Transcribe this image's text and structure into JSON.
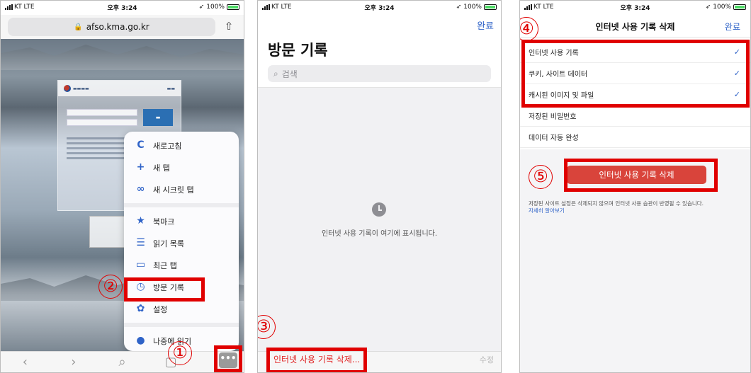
{
  "status": {
    "carrier": "KT LTE",
    "time": "오후 3:24",
    "battery": "100%"
  },
  "phone1": {
    "address": "afso.kma.go.kr",
    "menu_groups": [
      [
        {
          "icon": "reload-icon",
          "glyph": "C",
          "label": "새로고침"
        },
        {
          "icon": "plus-icon",
          "glyph": "+",
          "label": "새 탭"
        },
        {
          "icon": "incognito-icon",
          "glyph": "∞",
          "label": "새 시크릿 탭"
        }
      ],
      [
        {
          "icon": "star-icon",
          "glyph": "★",
          "label": "북마크"
        },
        {
          "icon": "reading-list-icon",
          "glyph": "☰",
          "label": "읽기 목록"
        },
        {
          "icon": "recent-tabs-icon",
          "glyph": "▭",
          "label": "최근 탭"
        },
        {
          "icon": "history-icon",
          "glyph": "◷",
          "label": "방문 기록"
        },
        {
          "icon": "gear-icon",
          "glyph": "✿",
          "label": "설정"
        }
      ],
      [
        {
          "icon": "read-later-icon",
          "glyph": "●",
          "label": "나중에 읽기"
        }
      ]
    ],
    "toolbar": {
      "back": "‹",
      "forward": "›",
      "search": "⌕",
      "tabs": "▢",
      "more": "•••"
    }
  },
  "phone2": {
    "done": "완료",
    "title": "방문 기록",
    "search_placeholder": "검색",
    "empty_text": "인터넷 사용 기록이 여기에 표시됩니다.",
    "clear_label": "인터넷 사용 기록 삭제...",
    "edit_label": "수정"
  },
  "phone3": {
    "title": "인터넷 사용 기록 삭제",
    "done": "완료",
    "rows": [
      {
        "label": "인터넷 사용 기록",
        "checked": "✓"
      },
      {
        "label": "쿠키, 사이트 데이터",
        "checked": "✓"
      },
      {
        "label": "캐시된 이미지 및 파일",
        "checked": "✓"
      },
      {
        "label": "저장된 비밀번호",
        "checked": ""
      },
      {
        "label": "데이터 자동 완성",
        "checked": ""
      }
    ],
    "delete_label": "인터넷 사용 기록 삭제",
    "note": "저장된 사이트 설정은 삭제되지 않으며 인터넷 사용 습관이 반영될 수 있습니다.",
    "learn_more": "자세히 알아보기"
  },
  "steps": [
    "①",
    "②",
    "③",
    "④",
    "⑤"
  ],
  "colors": {
    "highlight": "#e00000",
    "accent": "#2f63c8",
    "destructive": "#d9443b"
  }
}
